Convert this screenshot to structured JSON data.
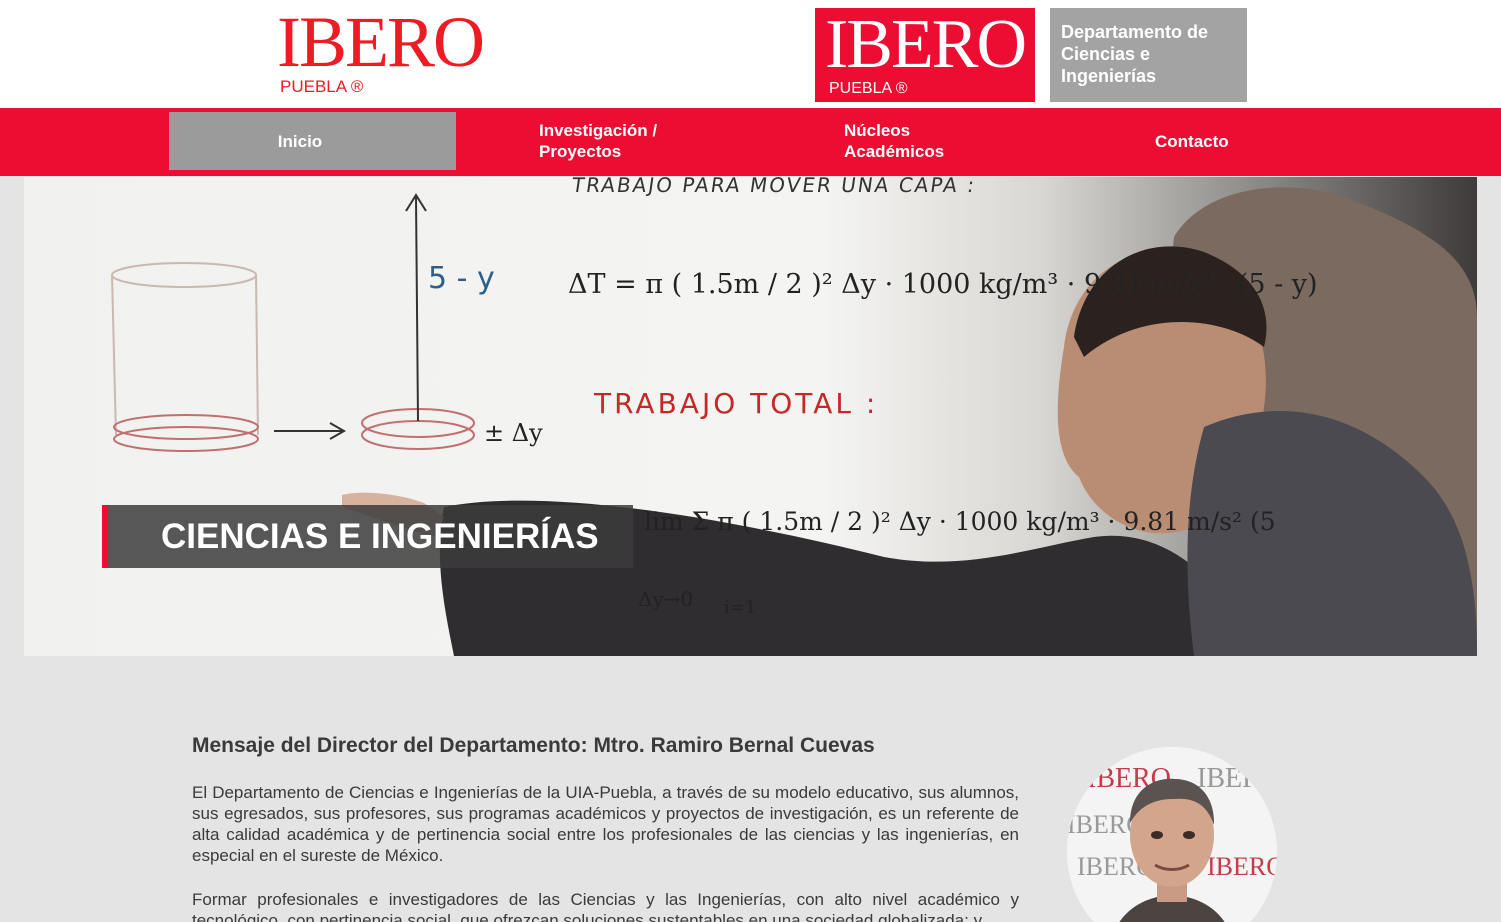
{
  "header": {
    "logo_left": {
      "word": "IBERO",
      "sub": "PUEBLA ®"
    },
    "logo_right": {
      "word": "IBERO",
      "sub": "PUEBLA ®",
      "dept_lines": [
        "Departamento de",
        "Ciencias e",
        "Ingenierías"
      ]
    }
  },
  "nav": {
    "items": [
      {
        "label": "Inicio",
        "active": true
      },
      {
        "label": "Investigación /\nProyectos"
      },
      {
        "label": "Núcleos\nAcadémicos"
      },
      {
        "label": "Contacto"
      }
    ]
  },
  "hero": {
    "banner_text": "CIENCIAS E INGENIERÍAS",
    "board_text": {
      "top": "TRABAJO PARA MOVER UNA CAPA :",
      "eq1": "ΔT = π ( 1.5m / 2 )² Δy · 1000 kg/m³ · 9.81 m/s² · (5 - y)",
      "label_left": "5 - y",
      "red": "TRABAJO TOTAL :",
      "eq2": "lim Σ π ( 1.5m / 2 )² Δy · 1000 kg/m³ · 9.81 m/s² (5",
      "limit": "Δy→0",
      "index": "i=1",
      "delta": "± Δy"
    }
  },
  "main": {
    "title": "Mensaje del Director del Departamento: Mtro. Ramiro Bernal Cuevas",
    "paragraphs": [
      "El Departamento de Ciencias e Ingenierías de la UIA-Puebla, a través de su modelo educativo, sus alumnos, sus egresados, sus profesores, sus programas académicos y proyectos de investigación, es un referente de alta calidad académica y de pertinencia social entre los profesionales de las ciencias y las ingenierías, en especial en el sureste de México.",
      "Formar profesionales e investigadores de las Ciencias y las Ingenierías, con alto nivel académico y tecnológico, con pertinencia social, que ofrezcan soluciones sustentables en una sociedad globalizada; y"
    ],
    "portrait_backdrop": "IBERO"
  },
  "colors": {
    "brand_red": "#ed0c32",
    "nav_active": "#9b9b9b",
    "dept_grey": "#a3a3a3",
    "background": "#e4e4e4"
  }
}
